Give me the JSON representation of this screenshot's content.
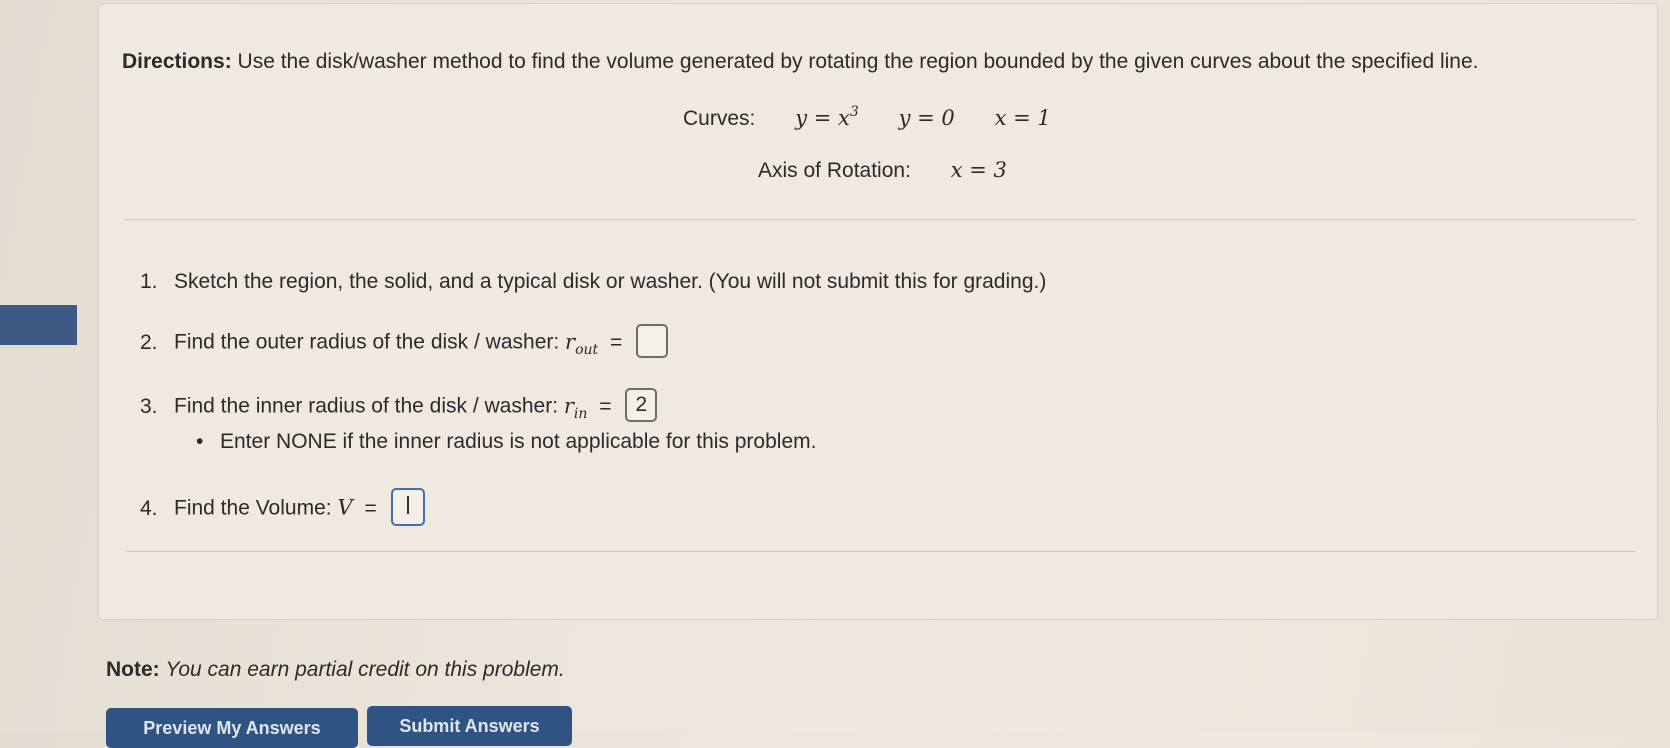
{
  "directions": {
    "label": "Directions:",
    "text": "Use the disk/washer method to find the volume generated by rotating the region bounded by the given curves about the specified line."
  },
  "curves": {
    "label": "Curves:",
    "eq1": "y = x",
    "eq1_exp": "3",
    "eq2": "y = 0",
    "eq3": "x = 1"
  },
  "axis": {
    "label": "Axis of Rotation:",
    "eq": "x = 3"
  },
  "steps": {
    "s1": {
      "num": "1.",
      "text": "Sketch the region, the solid, and a typical disk or washer. (You will not submit this for grading.)"
    },
    "s2": {
      "num": "2.",
      "text": "Find the outer radius of the disk / washer: ",
      "var": "r",
      "sub": "out",
      "eq": "=",
      "value": ""
    },
    "s3": {
      "num": "3.",
      "text": "Find the inner radius of the disk / washer: ",
      "var": "r",
      "sub": "in",
      "eq": "=",
      "value": "2"
    },
    "bullet": "Enter NONE if the inner radius is not applicable for this problem.",
    "s4": {
      "num": "4.",
      "text": "Find the Volume: ",
      "var": "V",
      "eq": "=",
      "value": ""
    }
  },
  "note": {
    "label": "Note:",
    "text": "You can earn partial credit on this problem."
  },
  "buttons": {
    "preview": "Preview My Answers",
    "submit": "Submit Answers"
  },
  "colors": {
    "accent": "#2f5484",
    "sidebar_tab": "#3d5a84"
  }
}
